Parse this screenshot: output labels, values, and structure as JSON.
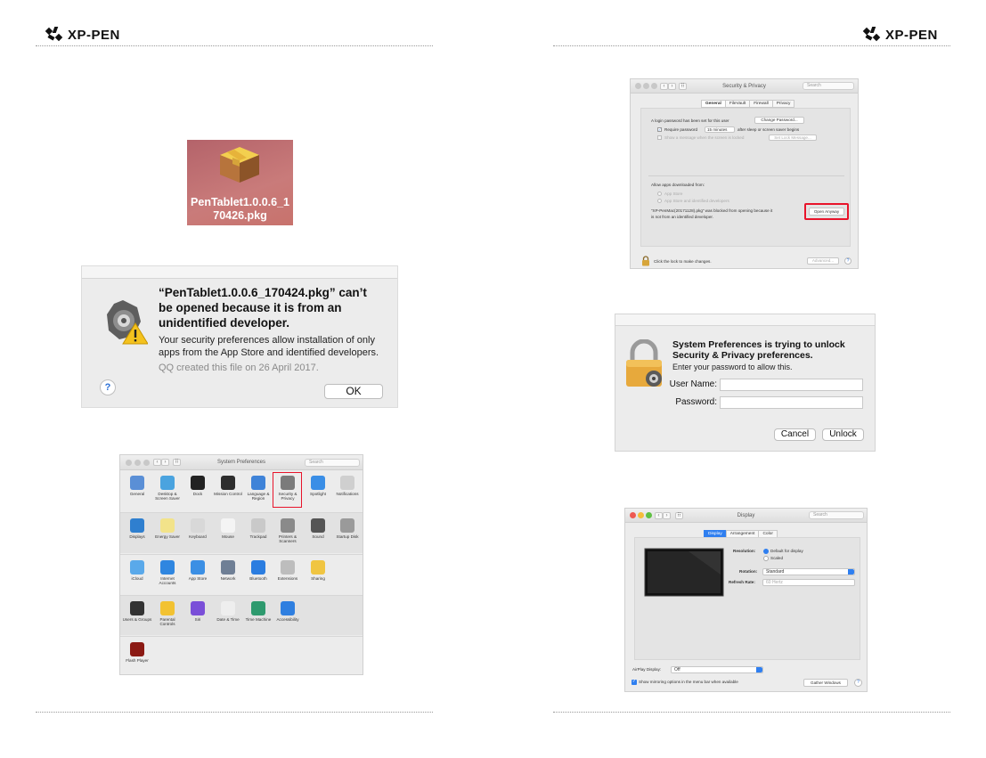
{
  "header": {
    "brand": "XP-PEN"
  },
  "pkg_icon": {
    "filename_line1": "PenTablet1.0.0.6_1",
    "filename_line2": "70426.pkg"
  },
  "unidentified_alert": {
    "title": "“PenTablet1.0.0.6_170424.pkg” can’t be opened because it is from an unidentified developer.",
    "body": "Your security preferences allow installation of only apps from the App Store and identified developers.",
    "meta": "QQ created this file on 26 April 2017.",
    "ok_label": "OK",
    "help_label": "?"
  },
  "system_preferences": {
    "title": "System Preferences",
    "search_placeholder": "Search",
    "rows": [
      [
        {
          "label": "General",
          "icon": "general-icon",
          "color": "#5a8fd6"
        },
        {
          "label": "Desktop & Screen Saver",
          "icon": "desktop-icon",
          "color": "#4aa3df"
        },
        {
          "label": "Dock",
          "icon": "dock-icon",
          "color": "#222222"
        },
        {
          "label": "Mission Control",
          "icon": "mission-control-icon",
          "color": "#2d2d2d"
        },
        {
          "label": "Language & Region",
          "icon": "language-icon",
          "color": "#3f83d8"
        },
        {
          "label": "Security & Privacy",
          "icon": "security-icon",
          "color": "#7b7b7b"
        },
        {
          "label": "Spotlight",
          "icon": "spotlight-icon",
          "color": "#3a8ee6"
        },
        {
          "label": "Notifications",
          "icon": "notifications-icon",
          "color": "#cfcfcf"
        }
      ],
      [
        {
          "label": "Displays",
          "icon": "displays-icon",
          "color": "#2f7fcf"
        },
        {
          "label": "Energy Saver",
          "icon": "energy-icon",
          "color": "#f2e38a"
        },
        {
          "label": "Keyboard",
          "icon": "keyboard-icon",
          "color": "#d8d8d8"
        },
        {
          "label": "Mouse",
          "icon": "mouse-icon",
          "color": "#f4f4f4"
        },
        {
          "label": "Trackpad",
          "icon": "trackpad-icon",
          "color": "#c9c9c9"
        },
        {
          "label": "Printers & Scanners",
          "icon": "printer-icon",
          "color": "#8a8a8a"
        },
        {
          "label": "Sound",
          "icon": "sound-icon",
          "color": "#555555"
        },
        {
          "label": "Startup Disk",
          "icon": "startup-disk-icon",
          "color": "#9a9a9a"
        }
      ],
      [
        {
          "label": "iCloud",
          "icon": "icloud-icon",
          "color": "#5aa9ea"
        },
        {
          "label": "Internet Accounts",
          "icon": "internet-accounts-icon",
          "color": "#2f86e0"
        },
        {
          "label": "App Store",
          "icon": "app-store-icon",
          "color": "#3b8fe4"
        },
        {
          "label": "Network",
          "icon": "network-icon",
          "color": "#6f7f95"
        },
        {
          "label": "Bluetooth",
          "icon": "bluetooth-icon",
          "color": "#2b7de0"
        },
        {
          "label": "Extensions",
          "icon": "extensions-icon",
          "color": "#bdbdbd"
        },
        {
          "label": "Sharing",
          "icon": "sharing-icon",
          "color": "#f0c542"
        }
      ],
      [
        {
          "label": "Users & Groups",
          "icon": "users-icon",
          "color": "#333333"
        },
        {
          "label": "Parental Controls",
          "icon": "parental-icon",
          "color": "#f2c232"
        },
        {
          "label": "Siri",
          "icon": "siri-icon",
          "color": "#7a4fd8"
        },
        {
          "label": "Date & Time",
          "icon": "date-time-icon",
          "color": "#eeeeee"
        },
        {
          "label": "Time Machine",
          "icon": "time-machine-icon",
          "color": "#2e9a6e"
        },
        {
          "label": "Accessibility",
          "icon": "accessibility-icon",
          "color": "#2f7fe0"
        }
      ],
      [
        {
          "label": "Flash Player",
          "icon": "flash-player-icon",
          "color": "#8b1a14"
        }
      ]
    ]
  },
  "security_privacy": {
    "title": "Security & Privacy",
    "search_placeholder": "Search",
    "tabs": [
      "General",
      "FileVault",
      "Firewall",
      "Privacy"
    ],
    "login_password_text": "A login password has been set for this user",
    "change_password_label": "Change Password...",
    "require_password_label": "Require password",
    "require_password_value": "15 minutes",
    "after_sleep_text": "after sleep or screen saver begins",
    "show_message_label": "Show a message when the screen is locked",
    "set_lock_message_label": "Set Lock Message...",
    "allow_apps_label": "Allow apps downloaded from:",
    "app_store_option": "App Store",
    "app_store_dev_option": "App Store and identified developers",
    "blocked_text_line1": "“XP-PenMac(20171128).pkg” was blocked from opening because it",
    "blocked_text_line2": "is not from an identified developer.",
    "open_anyway_label": "Open Anyway",
    "lock_text": "Click the lock to make changes.",
    "advanced_label": "Advanced...",
    "help_label": "?",
    "highlight_color": "#e8142b"
  },
  "unlock_dialog": {
    "title": "System Preferences is trying to unlock Security & Privacy preferences.",
    "body": "Enter your password to allow this.",
    "username_label": "User Name:",
    "password_label": "Password:",
    "cancel_label": "Cancel",
    "unlock_label": "Unlock"
  },
  "display_window": {
    "title": "Display",
    "search_placeholder": "Search",
    "tabs": [
      "Display",
      "Arrangement",
      "Color"
    ],
    "resolution_label": "Resolution:",
    "resolution_default": "Default for display",
    "resolution_scaled": "Scaled",
    "rotation_label": "Rotation:",
    "rotation_value": "Standard",
    "refresh_label": "Refresh Rate:",
    "refresh_value": "60 Hertz",
    "airplay_label": "AirPlay Display:",
    "airplay_value": "Off",
    "mirroring_label": "Show mirroring options in the menu bar when available",
    "gather_label": "Gather Windows",
    "help_label": "?"
  }
}
